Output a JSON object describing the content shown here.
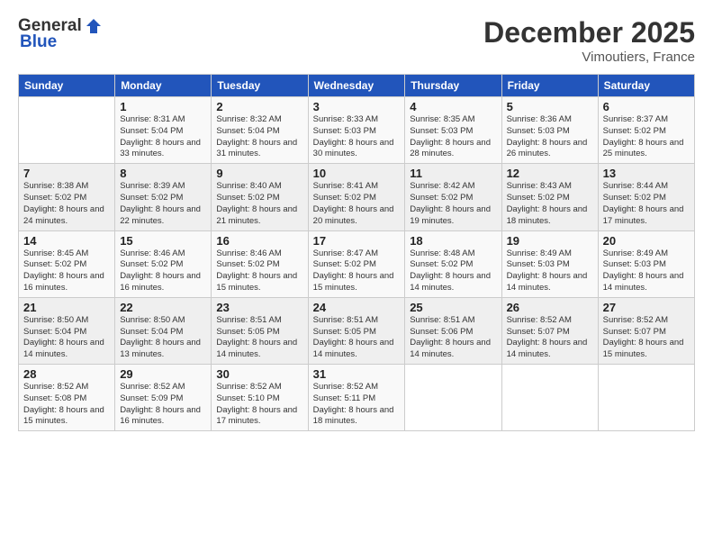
{
  "header": {
    "logo_general": "General",
    "logo_blue": "Blue",
    "title": "December 2025",
    "location": "Vimoutiers, France"
  },
  "days_of_week": [
    "Sunday",
    "Monday",
    "Tuesday",
    "Wednesday",
    "Thursday",
    "Friday",
    "Saturday"
  ],
  "weeks": [
    [
      {
        "day": "",
        "sunrise": "",
        "sunset": "",
        "daylight": ""
      },
      {
        "day": "1",
        "sunrise": "Sunrise: 8:31 AM",
        "sunset": "Sunset: 5:04 PM",
        "daylight": "Daylight: 8 hours and 33 minutes."
      },
      {
        "day": "2",
        "sunrise": "Sunrise: 8:32 AM",
        "sunset": "Sunset: 5:04 PM",
        "daylight": "Daylight: 8 hours and 31 minutes."
      },
      {
        "day": "3",
        "sunrise": "Sunrise: 8:33 AM",
        "sunset": "Sunset: 5:03 PM",
        "daylight": "Daylight: 8 hours and 30 minutes."
      },
      {
        "day": "4",
        "sunrise": "Sunrise: 8:35 AM",
        "sunset": "Sunset: 5:03 PM",
        "daylight": "Daylight: 8 hours and 28 minutes."
      },
      {
        "day": "5",
        "sunrise": "Sunrise: 8:36 AM",
        "sunset": "Sunset: 5:03 PM",
        "daylight": "Daylight: 8 hours and 26 minutes."
      },
      {
        "day": "6",
        "sunrise": "Sunrise: 8:37 AM",
        "sunset": "Sunset: 5:02 PM",
        "daylight": "Daylight: 8 hours and 25 minutes."
      }
    ],
    [
      {
        "day": "7",
        "sunrise": "Sunrise: 8:38 AM",
        "sunset": "Sunset: 5:02 PM",
        "daylight": "Daylight: 8 hours and 24 minutes."
      },
      {
        "day": "8",
        "sunrise": "Sunrise: 8:39 AM",
        "sunset": "Sunset: 5:02 PM",
        "daylight": "Daylight: 8 hours and 22 minutes."
      },
      {
        "day": "9",
        "sunrise": "Sunrise: 8:40 AM",
        "sunset": "Sunset: 5:02 PM",
        "daylight": "Daylight: 8 hours and 21 minutes."
      },
      {
        "day": "10",
        "sunrise": "Sunrise: 8:41 AM",
        "sunset": "Sunset: 5:02 PM",
        "daylight": "Daylight: 8 hours and 20 minutes."
      },
      {
        "day": "11",
        "sunrise": "Sunrise: 8:42 AM",
        "sunset": "Sunset: 5:02 PM",
        "daylight": "Daylight: 8 hours and 19 minutes."
      },
      {
        "day": "12",
        "sunrise": "Sunrise: 8:43 AM",
        "sunset": "Sunset: 5:02 PM",
        "daylight": "Daylight: 8 hours and 18 minutes."
      },
      {
        "day": "13",
        "sunrise": "Sunrise: 8:44 AM",
        "sunset": "Sunset: 5:02 PM",
        "daylight": "Daylight: 8 hours and 17 minutes."
      }
    ],
    [
      {
        "day": "14",
        "sunrise": "Sunrise: 8:45 AM",
        "sunset": "Sunset: 5:02 PM",
        "daylight": "Daylight: 8 hours and 16 minutes."
      },
      {
        "day": "15",
        "sunrise": "Sunrise: 8:46 AM",
        "sunset": "Sunset: 5:02 PM",
        "daylight": "Daylight: 8 hours and 16 minutes."
      },
      {
        "day": "16",
        "sunrise": "Sunrise: 8:46 AM",
        "sunset": "Sunset: 5:02 PM",
        "daylight": "Daylight: 8 hours and 15 minutes."
      },
      {
        "day": "17",
        "sunrise": "Sunrise: 8:47 AM",
        "sunset": "Sunset: 5:02 PM",
        "daylight": "Daylight: 8 hours and 15 minutes."
      },
      {
        "day": "18",
        "sunrise": "Sunrise: 8:48 AM",
        "sunset": "Sunset: 5:02 PM",
        "daylight": "Daylight: 8 hours and 14 minutes."
      },
      {
        "day": "19",
        "sunrise": "Sunrise: 8:49 AM",
        "sunset": "Sunset: 5:03 PM",
        "daylight": "Daylight: 8 hours and 14 minutes."
      },
      {
        "day": "20",
        "sunrise": "Sunrise: 8:49 AM",
        "sunset": "Sunset: 5:03 PM",
        "daylight": "Daylight: 8 hours and 14 minutes."
      }
    ],
    [
      {
        "day": "21",
        "sunrise": "Sunrise: 8:50 AM",
        "sunset": "Sunset: 5:04 PM",
        "daylight": "Daylight: 8 hours and 14 minutes."
      },
      {
        "day": "22",
        "sunrise": "Sunrise: 8:50 AM",
        "sunset": "Sunset: 5:04 PM",
        "daylight": "Daylight: 8 hours and 13 minutes."
      },
      {
        "day": "23",
        "sunrise": "Sunrise: 8:51 AM",
        "sunset": "Sunset: 5:05 PM",
        "daylight": "Daylight: 8 hours and 14 minutes."
      },
      {
        "day": "24",
        "sunrise": "Sunrise: 8:51 AM",
        "sunset": "Sunset: 5:05 PM",
        "daylight": "Daylight: 8 hours and 14 minutes."
      },
      {
        "day": "25",
        "sunrise": "Sunrise: 8:51 AM",
        "sunset": "Sunset: 5:06 PM",
        "daylight": "Daylight: 8 hours and 14 minutes."
      },
      {
        "day": "26",
        "sunrise": "Sunrise: 8:52 AM",
        "sunset": "Sunset: 5:07 PM",
        "daylight": "Daylight: 8 hours and 14 minutes."
      },
      {
        "day": "27",
        "sunrise": "Sunrise: 8:52 AM",
        "sunset": "Sunset: 5:07 PM",
        "daylight": "Daylight: 8 hours and 15 minutes."
      }
    ],
    [
      {
        "day": "28",
        "sunrise": "Sunrise: 8:52 AM",
        "sunset": "Sunset: 5:08 PM",
        "daylight": "Daylight: 8 hours and 15 minutes."
      },
      {
        "day": "29",
        "sunrise": "Sunrise: 8:52 AM",
        "sunset": "Sunset: 5:09 PM",
        "daylight": "Daylight: 8 hours and 16 minutes."
      },
      {
        "day": "30",
        "sunrise": "Sunrise: 8:52 AM",
        "sunset": "Sunset: 5:10 PM",
        "daylight": "Daylight: 8 hours and 17 minutes."
      },
      {
        "day": "31",
        "sunrise": "Sunrise: 8:52 AM",
        "sunset": "Sunset: 5:11 PM",
        "daylight": "Daylight: 8 hours and 18 minutes."
      },
      {
        "day": "",
        "sunrise": "",
        "sunset": "",
        "daylight": ""
      },
      {
        "day": "",
        "sunrise": "",
        "sunset": "",
        "daylight": ""
      },
      {
        "day": "",
        "sunrise": "",
        "sunset": "",
        "daylight": ""
      }
    ]
  ]
}
